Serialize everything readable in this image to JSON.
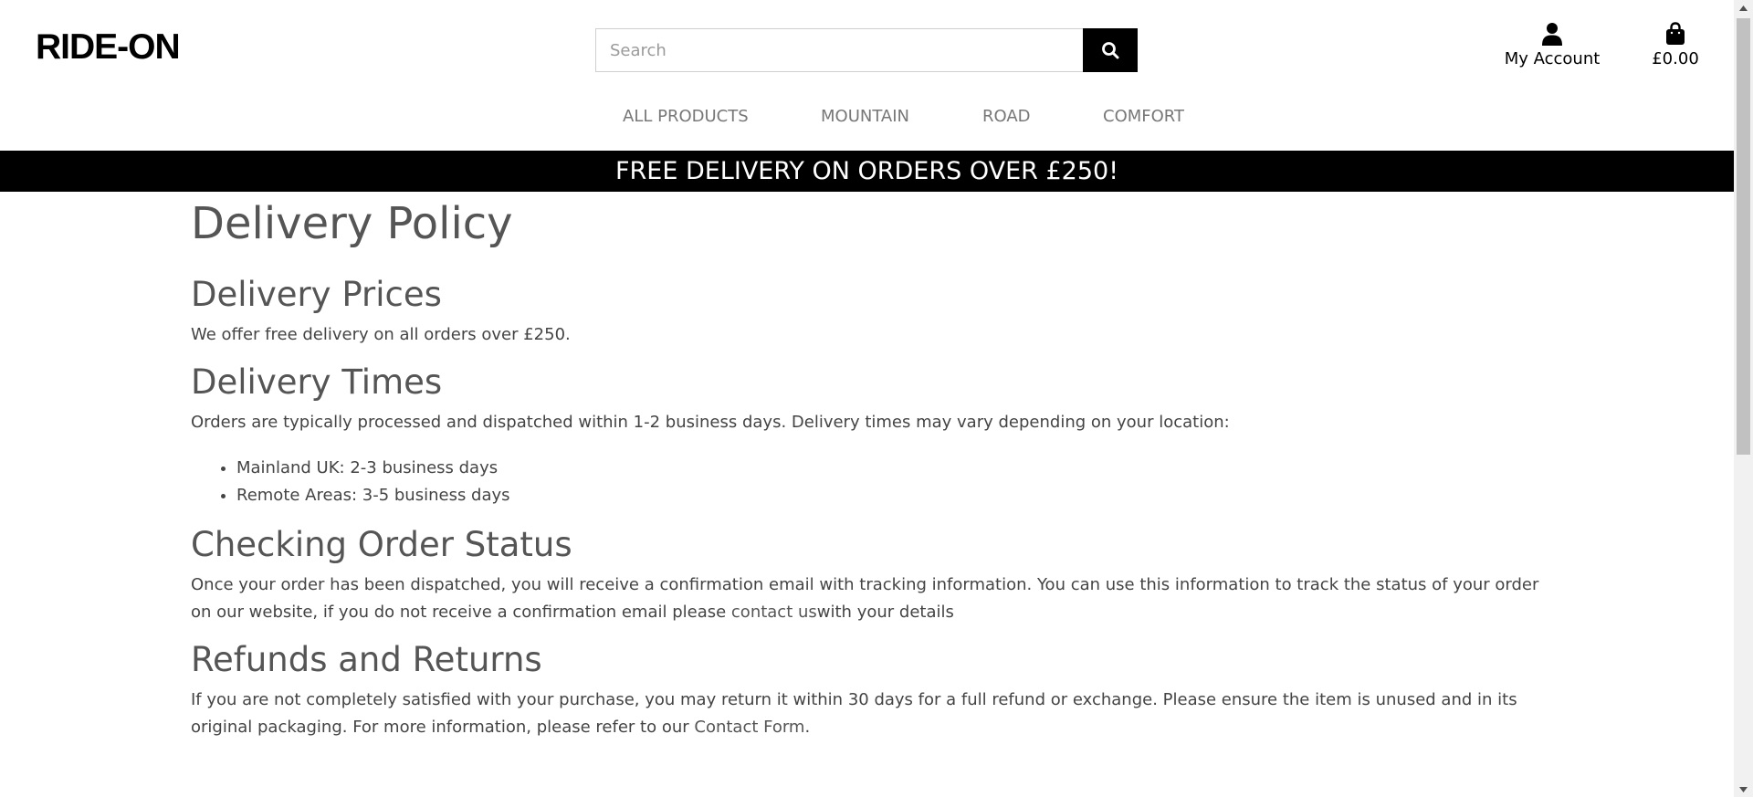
{
  "header": {
    "logo": "RIDE-ON",
    "search_placeholder": "Search",
    "account_label": "My Account",
    "bag_total": "£0.00",
    "icons": {
      "search": "search-icon",
      "account": "user-icon",
      "bag": "shopping-bag-icon"
    }
  },
  "nav": {
    "items": [
      {
        "label": "ALL PRODUCTS"
      },
      {
        "label": "MOUNTAIN"
      },
      {
        "label": "ROAD"
      },
      {
        "label": "COMFORT"
      }
    ]
  },
  "banner": {
    "text": "FREE DELIVERY ON ORDERS OVER £250!"
  },
  "page": {
    "title": "Delivery Policy",
    "sections": [
      {
        "heading": "Delivery Prices",
        "text": "We offer free delivery on all orders over £250."
      },
      {
        "heading": "Delivery Times",
        "text": "Orders are typically processed and dispatched within 1-2 business days. Delivery times may vary depending on your location:",
        "list": [
          "Mainland UK: 2-3 business days",
          "Remote Areas: 3-5 business days"
        ]
      },
      {
        "heading": "Checking Order Status",
        "text_before": "Once your order has been dispatched, you will receive a confirmation email with tracking information. You can use this information to track the status of your order on our website, if you do not receive a confirmation email please ",
        "link": "contact us",
        "text_after": "with your details"
      },
      {
        "heading": "Refunds and Returns",
        "text_before": "If you are not completely satisfied with your purchase, you may return it within 30 days for a full refund or exchange. Please ensure the item is unused and in its original packaging. For more information, please refer to our ",
        "link": "Contact Form",
        "text_after": "."
      }
    ]
  },
  "colors": {
    "banner_bg": "#000000",
    "banner_text": "#ffffff",
    "heading": "#555555",
    "nav": "#777777"
  }
}
